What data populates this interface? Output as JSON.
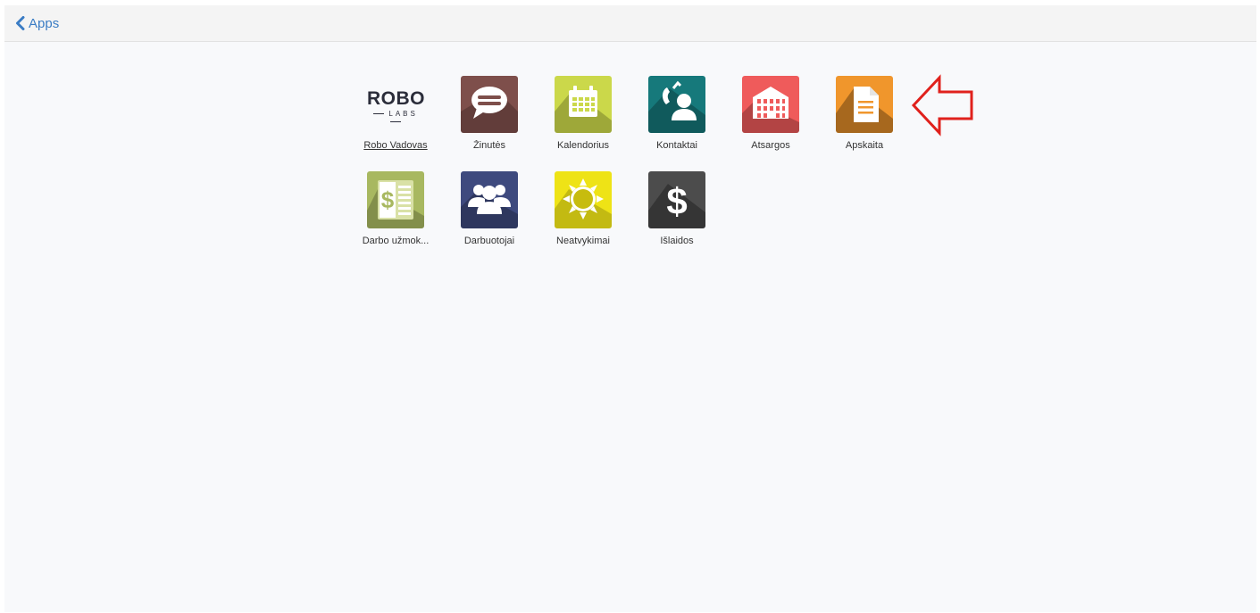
{
  "header": {
    "back_label": "Apps",
    "back_icon": "chevron-left-icon",
    "accent": "#3a7cc4"
  },
  "logo": {
    "line1": "ROBO",
    "line2": "LABS"
  },
  "apps": [
    {
      "label": "Robo Vadovas",
      "icon": "robolabs-logo"
    },
    {
      "label": "Žinutės",
      "icon": "chat-bubble-icon",
      "color": "#7e4f4b"
    },
    {
      "label": "Kalendorius",
      "icon": "calendar-icon",
      "color": "#cbd84a"
    },
    {
      "label": "Kontaktai",
      "icon": "contact-icon",
      "color": "#16797b"
    },
    {
      "label": "Atsargos",
      "icon": "warehouse-icon",
      "color": "#ef5b5b"
    },
    {
      "label": "Apskaita",
      "icon": "document-icon",
      "color": "#f0962c"
    },
    {
      "label": "Darbo užmok...",
      "icon": "payroll-icon",
      "color": "#a8b860"
    },
    {
      "label": "Darbuotojai",
      "icon": "people-icon",
      "color": "#3e4a7e"
    },
    {
      "label": "Neatvykimai",
      "icon": "sun-icon",
      "color": "#eee316"
    },
    {
      "label": "Išlaidos",
      "icon": "dollar-icon",
      "color": "#4c4c4c"
    }
  ],
  "annotation": {
    "icon": "red-arrow-left-icon",
    "color": "#e0211c"
  }
}
